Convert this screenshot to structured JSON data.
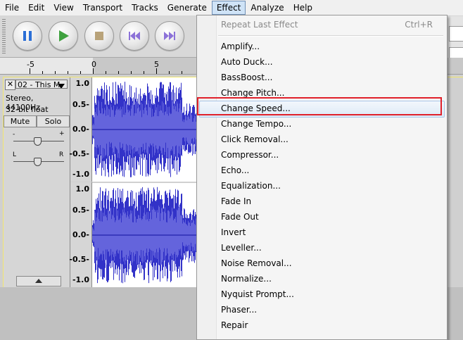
{
  "menubar": {
    "items": [
      "File",
      "Edit",
      "View",
      "Transport",
      "Tracks",
      "Generate",
      "Effect",
      "Analyze",
      "Help"
    ],
    "active": "Effect"
  },
  "ruler": {
    "labels": [
      "-5",
      "0",
      "5"
    ]
  },
  "track": {
    "name": "02 - This M",
    "format": "Stereo, 44100Hz",
    "bitdepth": "32-bit float",
    "mute_label": "Mute",
    "solo_label": "Solo",
    "gain_minus": "-",
    "gain_plus": "+",
    "pan_left": "L",
    "pan_right": "R",
    "close_glyph": "✕"
  },
  "vruler": {
    "labels": [
      "1.0",
      "0.5-",
      "0.0-",
      "-0.5-",
      "-1.0"
    ]
  },
  "effect_menu": {
    "repeat_last": "Repeat Last Effect",
    "repeat_shortcut": "Ctrl+R",
    "items": [
      "Amplify...",
      "Auto Duck...",
      "BassBoost...",
      "Change Pitch...",
      "Change Speed...",
      "Change Tempo...",
      "Click Removal...",
      "Compressor...",
      "Echo...",
      "Equalization...",
      "Fade In",
      "Fade Out",
      "Invert",
      "Leveller...",
      "Noise Removal...",
      "Normalize...",
      "Nyquist Prompt...",
      "Phaser...",
      "Repair"
    ],
    "hovered": "Change Speed..."
  },
  "colors": {
    "waveform": "#3232c8",
    "highlight": "#e0202a",
    "menu_hover": "#dde9f6"
  }
}
